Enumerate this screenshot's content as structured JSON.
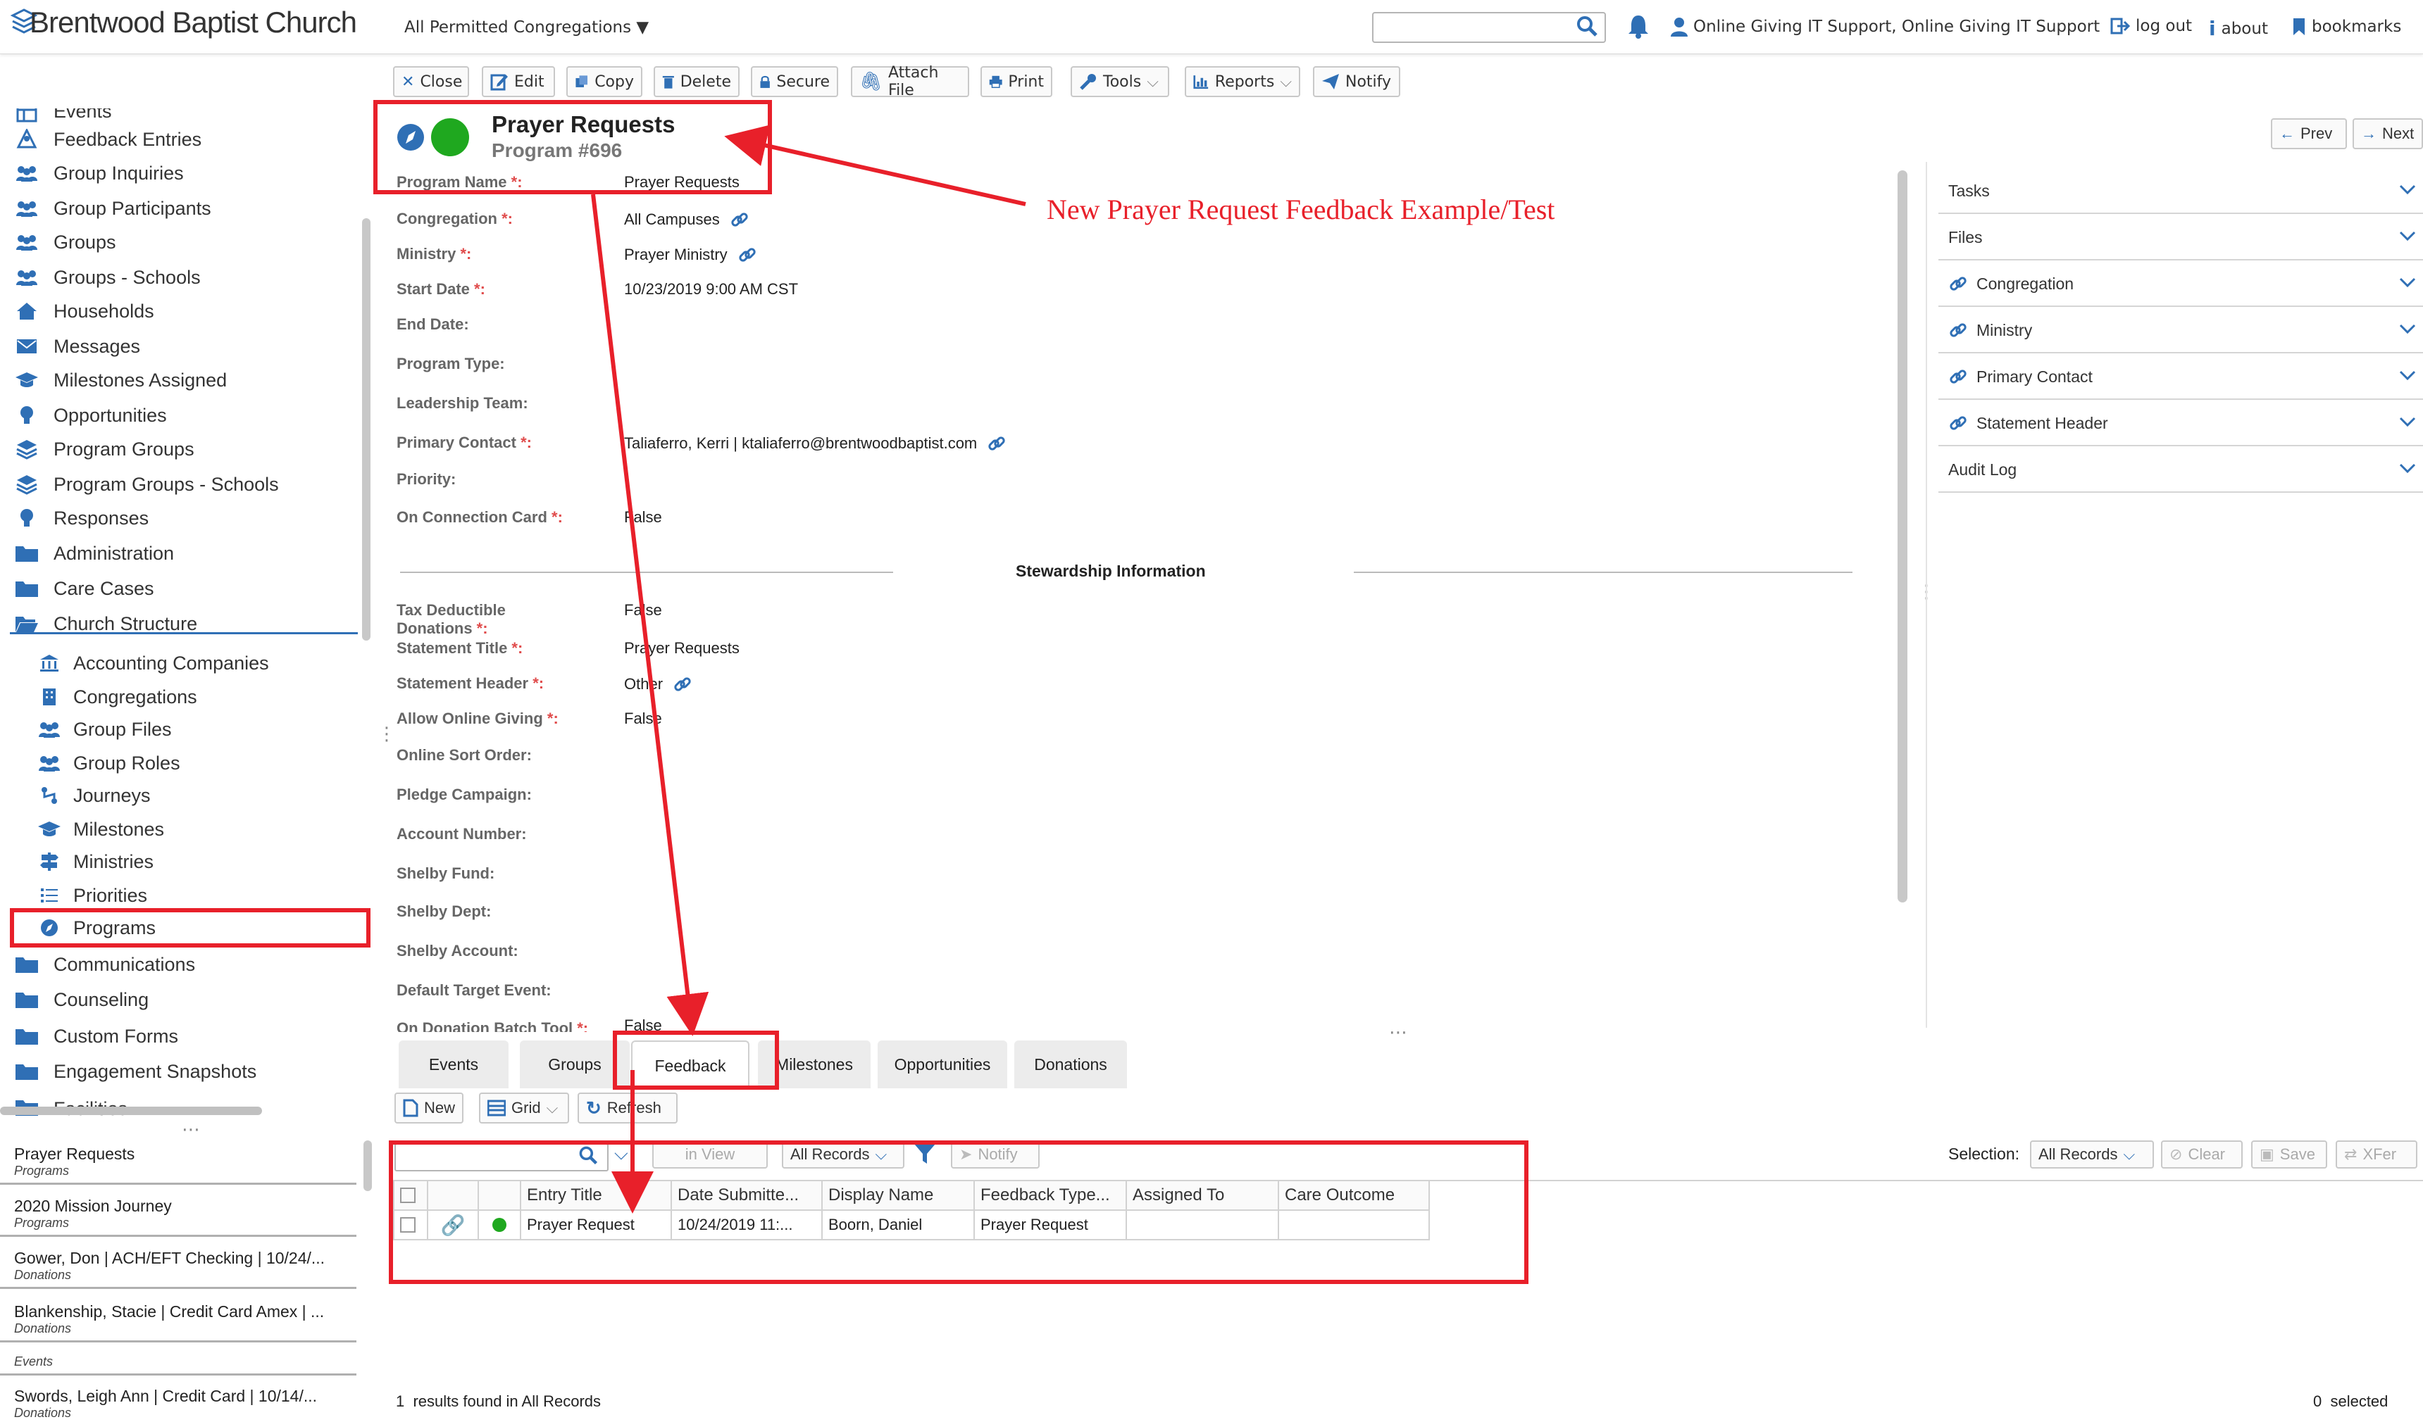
{
  "app": {
    "brand": "Brentwood Baptist Church",
    "congregation_select": "All Permitted Congregations ▼",
    "user": "Online Giving IT Support, Online Giving IT Support",
    "logout": "log out",
    "about": "about",
    "bookmarks": "bookmarks"
  },
  "toolbar": {
    "close": "Close",
    "edit": "Edit",
    "copy": "Copy",
    "delete": "Delete",
    "secure": "Secure",
    "attach": "Attach File",
    "print": "Print",
    "tools": "Tools",
    "reports": "Reports",
    "notify": "Notify"
  },
  "sidebar": {
    "items": [
      {
        "label": "Events",
        "icon": "grid-icon"
      },
      {
        "label": "Feedback Entries",
        "icon": "feedback-icon"
      },
      {
        "label": "Group Inquiries",
        "icon": "people-icon"
      },
      {
        "label": "Group Participants",
        "icon": "people-icon"
      },
      {
        "label": "Groups",
        "icon": "people-icon"
      },
      {
        "label": "Groups - Schools",
        "icon": "people-icon"
      },
      {
        "label": "Households",
        "icon": "home-icon"
      },
      {
        "label": "Messages",
        "icon": "envelope-icon"
      },
      {
        "label": "Milestones Assigned",
        "icon": "graduation-icon"
      },
      {
        "label": "Opportunities",
        "icon": "lightbulb-icon"
      },
      {
        "label": "Program Groups",
        "icon": "layers-icon"
      },
      {
        "label": "Program Groups - Schools",
        "icon": "layers-icon"
      },
      {
        "label": "Responses",
        "icon": "lightbulb-icon"
      },
      {
        "label": "Administration",
        "icon": "folder-icon"
      },
      {
        "label": "Care Cases",
        "icon": "folder-icon"
      },
      {
        "label": "Church Structure",
        "icon": "folder-open-icon"
      }
    ],
    "subitems": [
      {
        "label": "Accounting Companies",
        "icon": "bank-icon"
      },
      {
        "label": "Congregations",
        "icon": "building-icon"
      },
      {
        "label": "Group Files",
        "icon": "people-icon"
      },
      {
        "label": "Group Roles",
        "icon": "people-icon"
      },
      {
        "label": "Journeys",
        "icon": "route-icon"
      },
      {
        "label": "Milestones",
        "icon": "graduation-icon"
      },
      {
        "label": "Ministries",
        "icon": "signpost-icon"
      },
      {
        "label": "Priorities",
        "icon": "list-icon"
      },
      {
        "label": "Programs",
        "icon": "compass-icon"
      }
    ],
    "items_after": [
      {
        "label": "Communications",
        "icon": "folder-icon"
      },
      {
        "label": "Counseling",
        "icon": "folder-icon"
      },
      {
        "label": "Custom Forms",
        "icon": "folder-icon"
      },
      {
        "label": "Engagement Snapshots",
        "icon": "folder-icon"
      },
      {
        "label": "Facilities",
        "icon": "folder-icon"
      }
    ]
  },
  "recent": [
    {
      "title": "Prayer Requests",
      "sub": "Programs"
    },
    {
      "title": "2020 Mission Journey",
      "sub": "Programs"
    },
    {
      "title": "Gower, Don | ACH/EFT Checking | 10/24/...",
      "sub": "Donations"
    },
    {
      "title": "Blankenship, Stacie | Credit Card Amex | ...",
      "sub": "Donations"
    },
    {
      "title": "",
      "sub": "Events"
    },
    {
      "title": "Swords, Leigh Ann | Credit Card | 10/14/...",
      "sub": "Donations"
    }
  ],
  "record": {
    "title": "Prayer Requests",
    "subtitle": "Program #696",
    "prev": "Prev",
    "next": "Next",
    "section_heading": "Stewardship Information"
  },
  "fields": [
    {
      "label": "Program Name",
      "req": " *:",
      "value": "Prayer Requests",
      "link": false
    },
    {
      "label": "Congregation",
      "req": " *:",
      "value": "All Campuses",
      "link": true
    },
    {
      "label": "Ministry",
      "req": " *:",
      "value": "Prayer Ministry",
      "link": true
    },
    {
      "label": "Start Date",
      "req": " *:",
      "value": "10/23/2019 9:00 AM CST",
      "link": false
    },
    {
      "label": "End Date:",
      "req": "",
      "value": "",
      "link": false
    },
    {
      "label": "Program Type:",
      "req": "",
      "value": "",
      "link": false
    },
    {
      "label": "Leadership Team:",
      "req": "",
      "value": "",
      "link": false
    },
    {
      "label": "Primary Contact",
      "req": " *:",
      "value": "Taliaferro, Kerri | ktaliaferro@brentwoodbaptist.com",
      "link": true
    },
    {
      "label": "Priority:",
      "req": "",
      "value": "",
      "link": false
    },
    {
      "label": "On Connection Card",
      "req": " *:",
      "value": "False",
      "link": false
    }
  ],
  "fields2": [
    {
      "label": "Tax Deductible",
      "label2": "Donations",
      "req": " *:",
      "value": "False",
      "link": false
    },
    {
      "label": "Statement Title",
      "req": " *:",
      "value": "Prayer Requests",
      "link": false
    },
    {
      "label": "Statement Header",
      "req": " *:",
      "value": "Other",
      "link": true
    },
    {
      "label": "Allow Online Giving",
      "req": " *:",
      "value": "False",
      "link": false
    },
    {
      "label": "Online Sort Order:",
      "req": "",
      "value": "",
      "link": false
    },
    {
      "label": "Pledge Campaign:",
      "req": "",
      "value": "",
      "link": false
    },
    {
      "label": "Account Number:",
      "req": "",
      "value": "",
      "link": false
    },
    {
      "label": "Shelby Fund:",
      "req": "",
      "value": "",
      "link": false
    },
    {
      "label": "Shelby Dept:",
      "req": "",
      "value": "",
      "link": false
    },
    {
      "label": "Shelby Account:",
      "req": "",
      "value": "",
      "link": false
    },
    {
      "label": "Default Target Event:",
      "req": "",
      "value": "",
      "link": false
    },
    {
      "label": "On Donation Batch Tool",
      "req": " *:",
      "value": "False",
      "link": false
    }
  ],
  "right_panel": [
    {
      "label": "Tasks",
      "link": false
    },
    {
      "label": "Files",
      "link": false
    },
    {
      "label": "Congregation",
      "link": true
    },
    {
      "label": "Ministry",
      "link": true
    },
    {
      "label": "Primary Contact",
      "link": true
    },
    {
      "label": "Statement Header",
      "link": true
    },
    {
      "label": "Audit Log",
      "link": false
    }
  ],
  "tabs": [
    "Events",
    "Groups",
    "Feedback",
    "Milestones",
    "Opportunities",
    "Donations"
  ],
  "subtoolbar": {
    "new": "New",
    "grid": "Grid",
    "refresh": "Refresh"
  },
  "filterbar": {
    "in_view": "in View",
    "records": "All Records",
    "notify": "Notify",
    "selection_label": "Selection:",
    "selection_value": "All Records",
    "clear": "Clear",
    "save": "Save",
    "xfer": "XFer"
  },
  "grid": {
    "columns": [
      "Entry Title",
      "Date Submitte...",
      "Display Name",
      "Feedback Type...",
      "Assigned To",
      "Care Outcome"
    ],
    "rows": [
      [
        "Prayer Request",
        "10/24/2019 11:...",
        "Boorn, Daniel",
        "Prayer Request",
        "",
        ""
      ]
    ]
  },
  "footer": {
    "results": "1  results found in All Records",
    "selected": "0  selected"
  },
  "annotation": {
    "text": "New Prayer Request Feedback Example/Test"
  },
  "colors": {
    "accent": "#2f6fb5",
    "status_green": "#1fa81f",
    "annotation_red": "#e8202a"
  }
}
